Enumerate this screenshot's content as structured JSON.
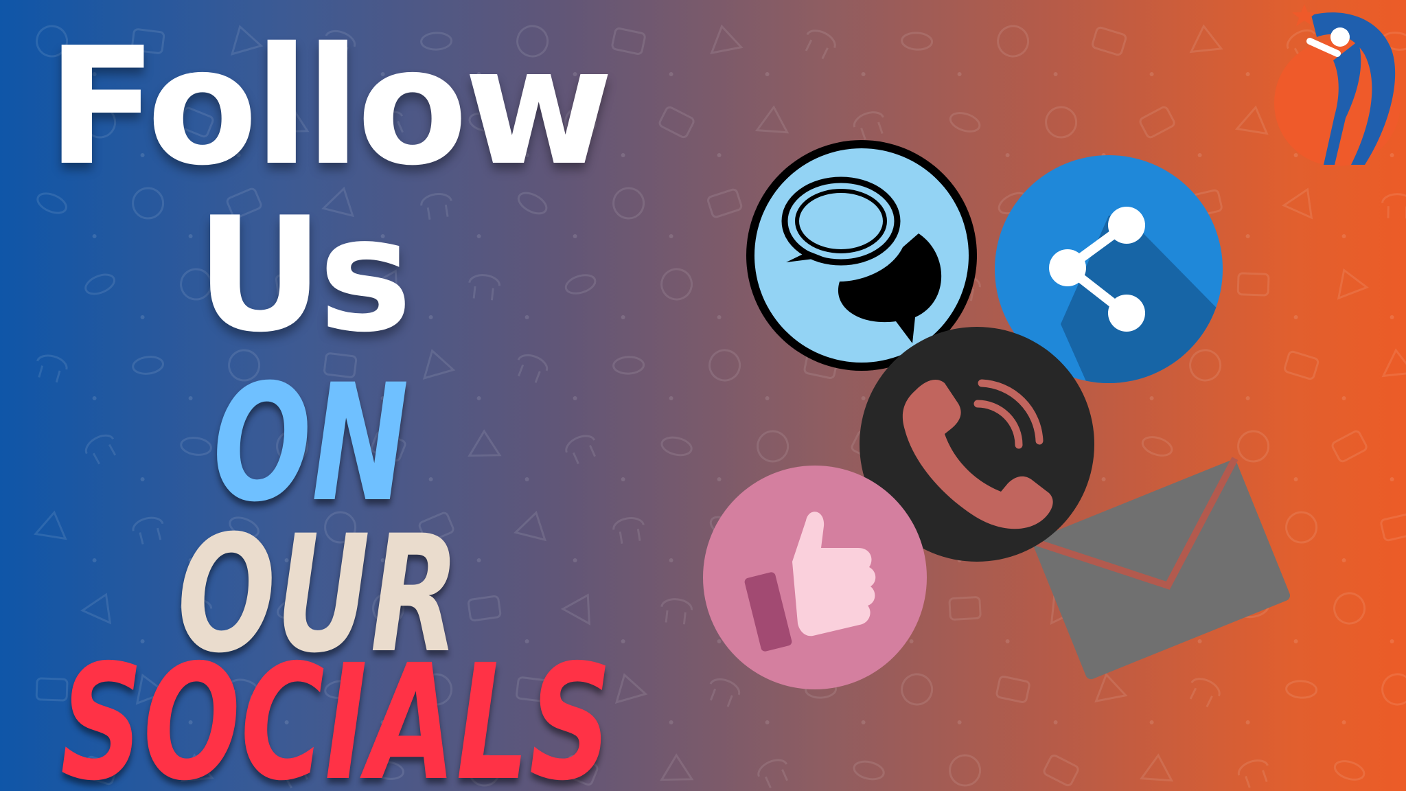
{
  "headline": {
    "line1": "Follow",
    "line2": "Us",
    "line3": "ON",
    "line4": "OUR",
    "line5": "SOCIALS"
  },
  "colors": {
    "gradient_left": "#0f56a8",
    "gradient_right": "#ec5c27",
    "headline_white": "#ffffff",
    "on_blue": "#6fc0ff",
    "our_beige": "#eadccd",
    "socials_red": "#ff3246",
    "chat_circle": "#93d3f4",
    "share_circle": "#1f88d9",
    "phone_circle": "#272727",
    "like_circle": "#d47f9f",
    "envelope_gray": "#707070",
    "logo_orange": "#ef5a2a",
    "logo_blue": "#1f5fae"
  },
  "icons": [
    "chat-bubbles-icon",
    "share-icon",
    "phone-icon",
    "thumbs-up-icon",
    "envelope-icon",
    "brand-logo"
  ]
}
